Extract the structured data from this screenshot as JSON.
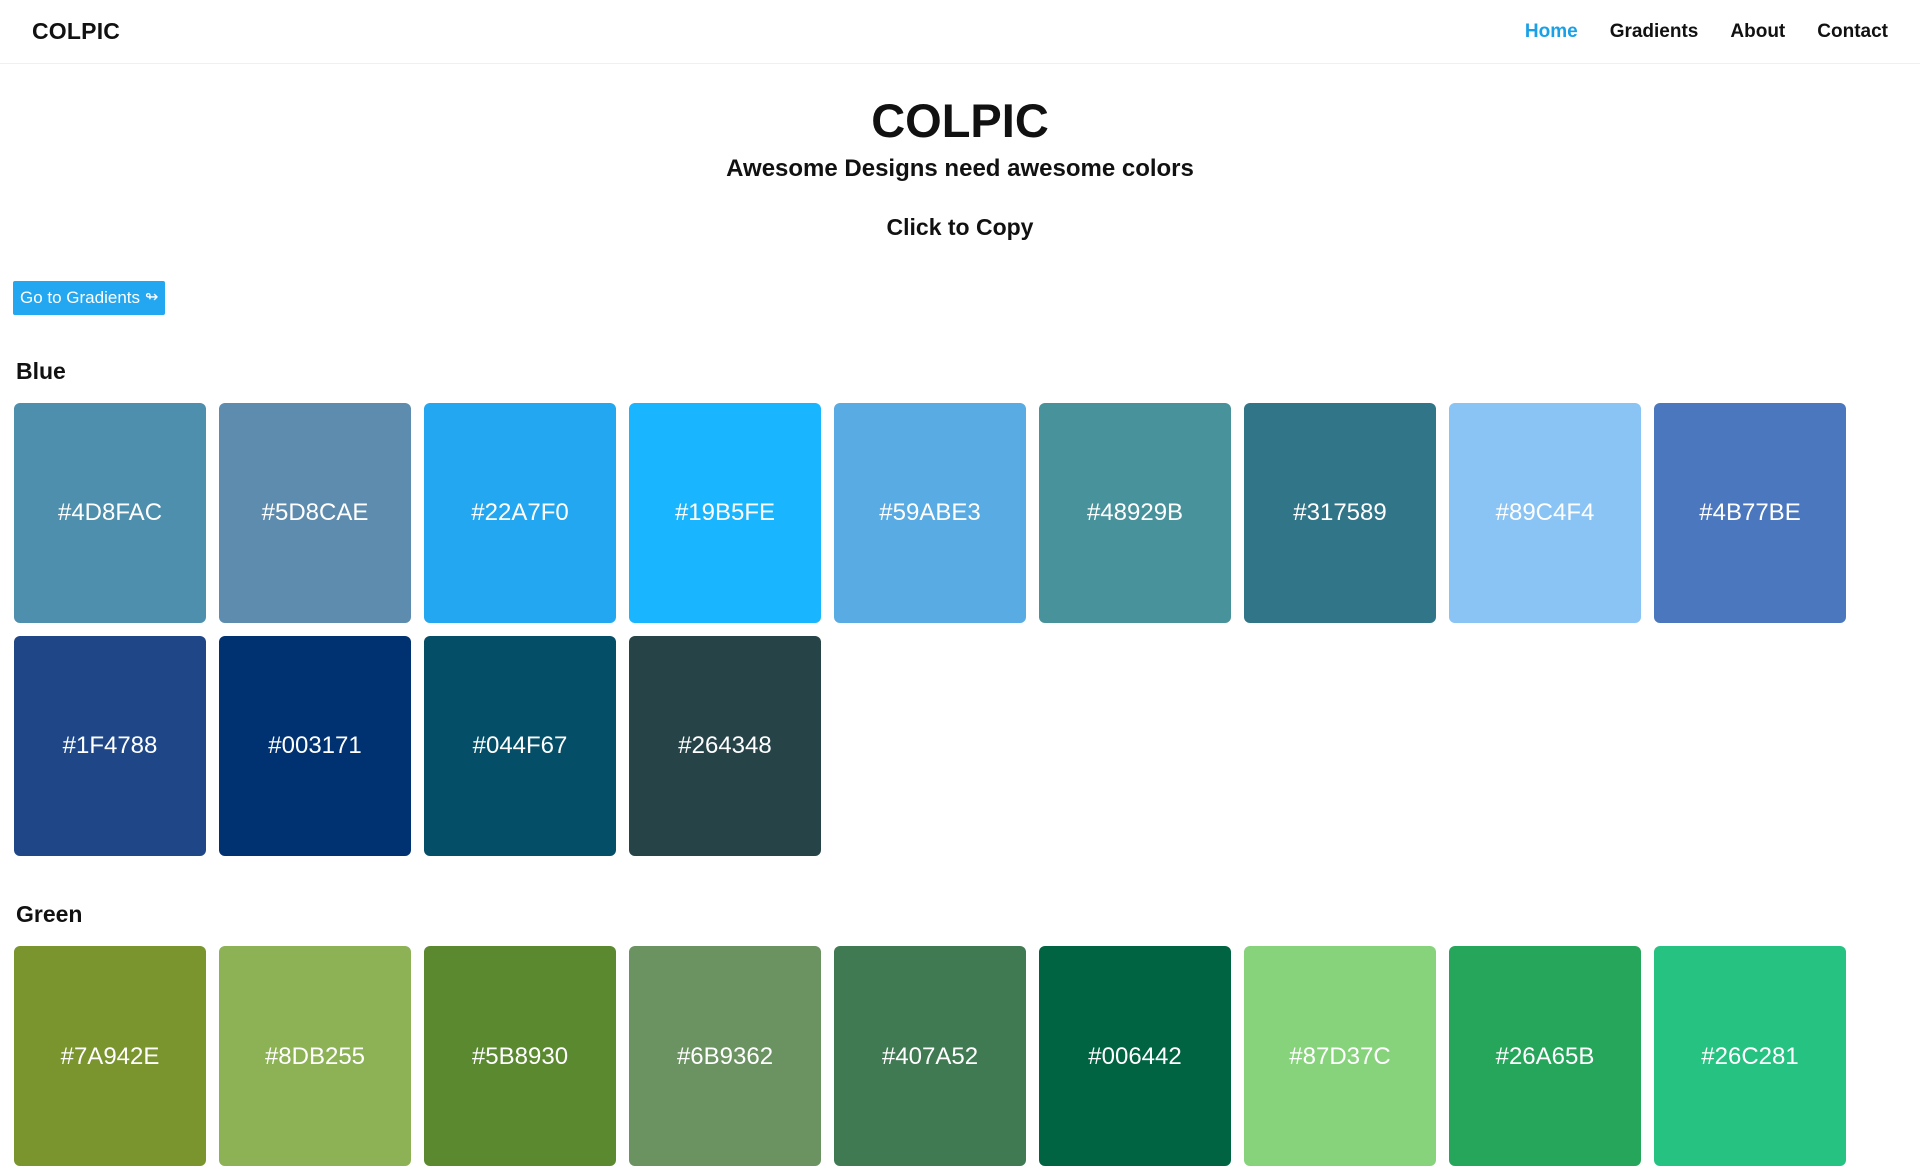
{
  "navbar": {
    "brand": "COLPIC",
    "links": [
      {
        "label": "Home",
        "active": true
      },
      {
        "label": "Gradients",
        "active": false
      },
      {
        "label": "About",
        "active": false
      },
      {
        "label": "Contact",
        "active": false
      }
    ]
  },
  "hero": {
    "title": "COLPIC",
    "subtitle": "Awesome Designs need awesome colors",
    "cta": "Click to Copy"
  },
  "gradient_button": {
    "label": "Go to Gradients",
    "icon": "arrow-right-icon",
    "glyph": "↬"
  },
  "sections": [
    {
      "title": "Blue",
      "colors": [
        "#4D8FAC",
        "#5D8CAE",
        "#22A7F0",
        "#19B5FE",
        "#59ABE3",
        "#48929B",
        "#317589",
        "#89C4F4",
        "#4B77BE",
        "#1F4788",
        "#003171",
        "#044F67",
        "#264348"
      ]
    },
    {
      "title": "Green",
      "colors": [
        "#7A942E",
        "#8DB255",
        "#5B8930",
        "#6B9362",
        "#407A52",
        "#006442",
        "#87D37C",
        "#26A65B",
        "#26C281"
      ]
    }
  ],
  "colors": {
    "accent": "#1AA0E6",
    "button": "#22A7F0",
    "text": "#111111",
    "background": "#FFFFFF"
  }
}
